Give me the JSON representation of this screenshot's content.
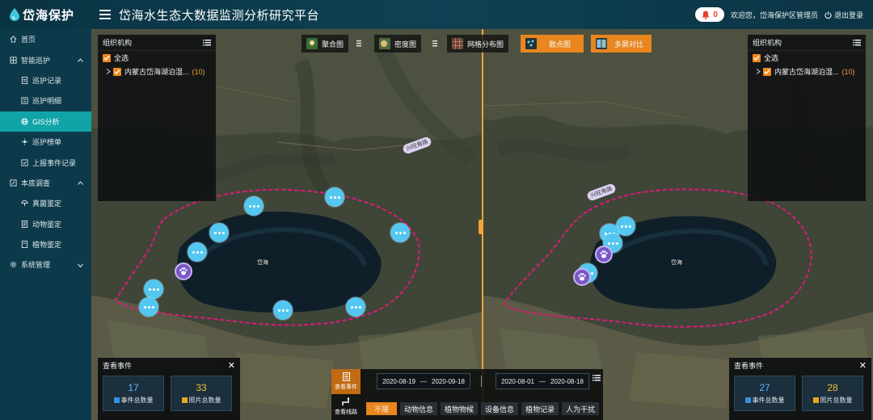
{
  "header": {
    "logo_text": "岱海保护",
    "platform_title": "岱海水生态大数据监测分析研究平台",
    "alert_count": "0",
    "welcome": "欢迎您，岱海保护区管理员",
    "logout": "退出登录"
  },
  "sidebar": {
    "items": [
      {
        "label": "首页",
        "icon": "home-icon"
      },
      {
        "label": "智能巡护",
        "icon": "patrol-icon"
      },
      {
        "label": "巡护记录",
        "icon": "record-icon"
      },
      {
        "label": "巡护明细",
        "icon": "detail-icon"
      },
      {
        "label": "GIS分析",
        "icon": "globe-icon"
      },
      {
        "label": "巡护榜单",
        "icon": "ranking-icon"
      },
      {
        "label": "上报事件记录",
        "icon": "report-icon"
      },
      {
        "label": "本底调查",
        "icon": "survey-icon"
      },
      {
        "label": "真菌鉴定",
        "icon": "fungus-icon"
      },
      {
        "label": "动物鉴定",
        "icon": "animal-icon"
      },
      {
        "label": "植物鉴定",
        "icon": "plant-icon"
      },
      {
        "label": "系统管理",
        "icon": "gear-icon"
      }
    ]
  },
  "toolbar": {
    "buttons": [
      {
        "label": "聚合图",
        "icon": "cluster-map-icon"
      },
      {
        "label": "密度图",
        "icon": "density-map-icon"
      },
      {
        "label": "网格分布图",
        "icon": "grid-map-icon"
      },
      {
        "label": "散点图",
        "icon": "scatter-map-icon"
      },
      {
        "label": "多屏对比",
        "icon": "split-screen-icon"
      }
    ]
  },
  "org_panel": {
    "title": "组织机构",
    "select_all": "全选",
    "org_name": "内蒙古岱海湖泊湿...",
    "org_count": "(10)"
  },
  "map_labels": {
    "lake": "岱海",
    "road": "兴旺角路"
  },
  "event_left": {
    "title": "查看事件",
    "event_total": "17",
    "event_label": "事件总数量",
    "photo_total": "33",
    "photo_label": "照片总数量"
  },
  "event_right": {
    "title": "查看事件",
    "event_total": "27",
    "event_label": "事件总数量",
    "photo_total": "28",
    "photo_label": "照片总数量"
  },
  "timeline": {
    "tab_events": "查看事件",
    "tab_routes": "查看线路",
    "left_start": "2020-08-19",
    "left_end": "2020-09-18",
    "right_start": "2020-08-01",
    "right_end": "2020-08-18",
    "dash": "—",
    "filters": [
      "不限",
      "动物信息",
      "植物物候",
      "设备信息",
      "植物记录",
      "人为干扰"
    ]
  }
}
